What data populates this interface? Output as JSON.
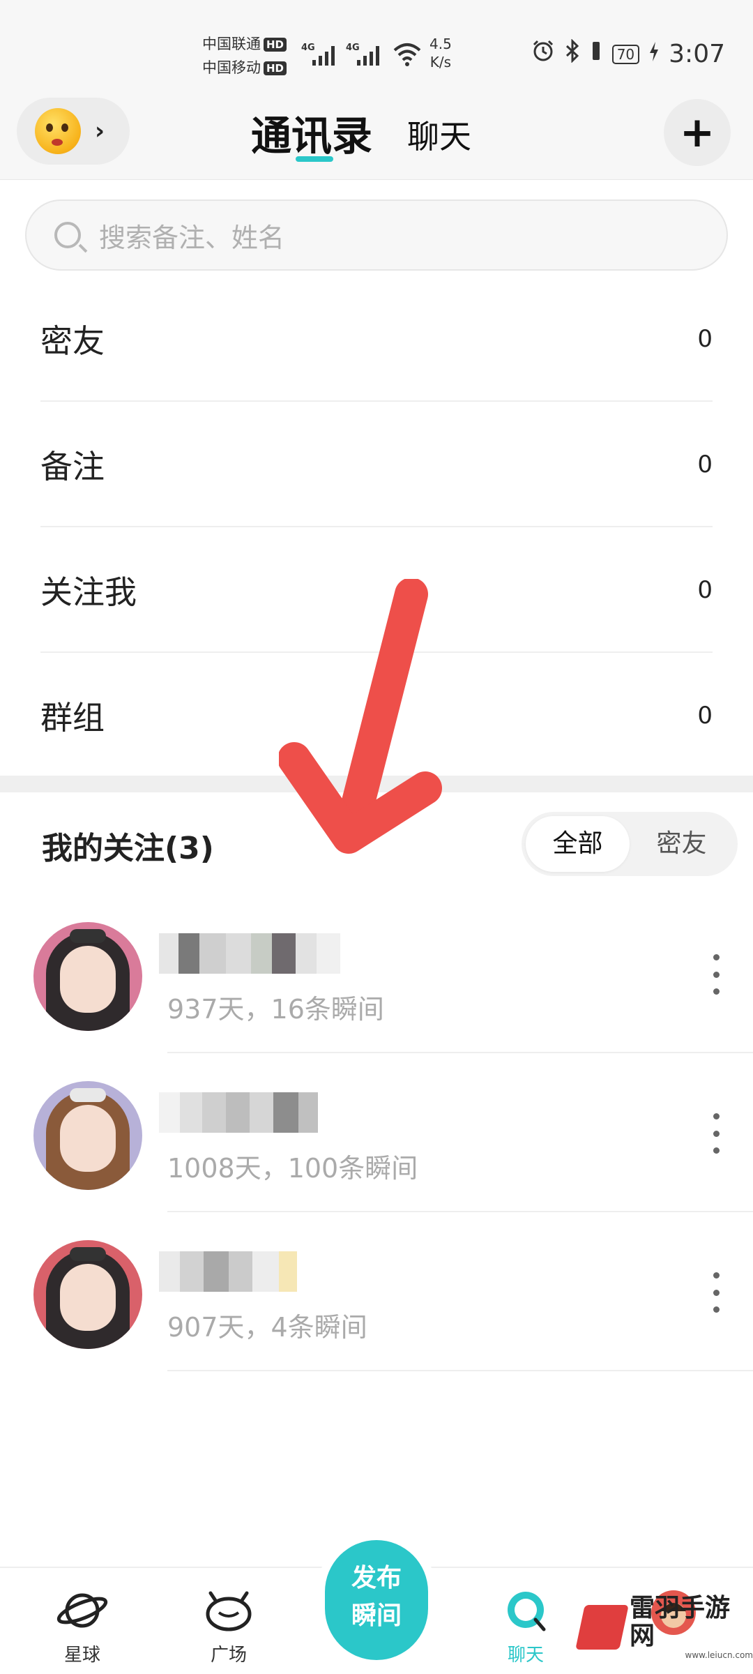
{
  "status_bar": {
    "carrier_1": "中国联通",
    "carrier_2": "中国移动",
    "hd_badge": "HD",
    "network_1": "4G",
    "network_2": "4G",
    "speed_value": "4.5",
    "speed_unit": "K/s",
    "battery": "70",
    "time": "3:07"
  },
  "header": {
    "tab_contacts": "通讯录",
    "tab_chat": "聊天",
    "add_button": "+",
    "chevron": "›"
  },
  "search": {
    "placeholder": "搜索备注、姓名"
  },
  "categories": [
    {
      "name": "密友",
      "count": "0"
    },
    {
      "name": "备注",
      "count": "0"
    },
    {
      "name": "关注我",
      "count": "0"
    },
    {
      "name": "群组",
      "count": "0"
    }
  ],
  "following": {
    "title": "我的关注(3)",
    "filter_all": "全部",
    "filter_close": "密友",
    "contacts": [
      {
        "meta": "937天，16条瞬间"
      },
      {
        "meta": "1008天，100条瞬间"
      },
      {
        "meta": "907天，4条瞬间"
      }
    ]
  },
  "bottom_nav": {
    "planet": "星球",
    "plaza": "广场",
    "publish_line1": "发布",
    "publish_line2": "瞬间",
    "chat": "聊天"
  },
  "watermark": {
    "name": "雷羽手游网",
    "url": "www.leiucn.com"
  },
  "colors": {
    "accent": "#2bc7c9",
    "arrow": "#ee4f4a"
  }
}
